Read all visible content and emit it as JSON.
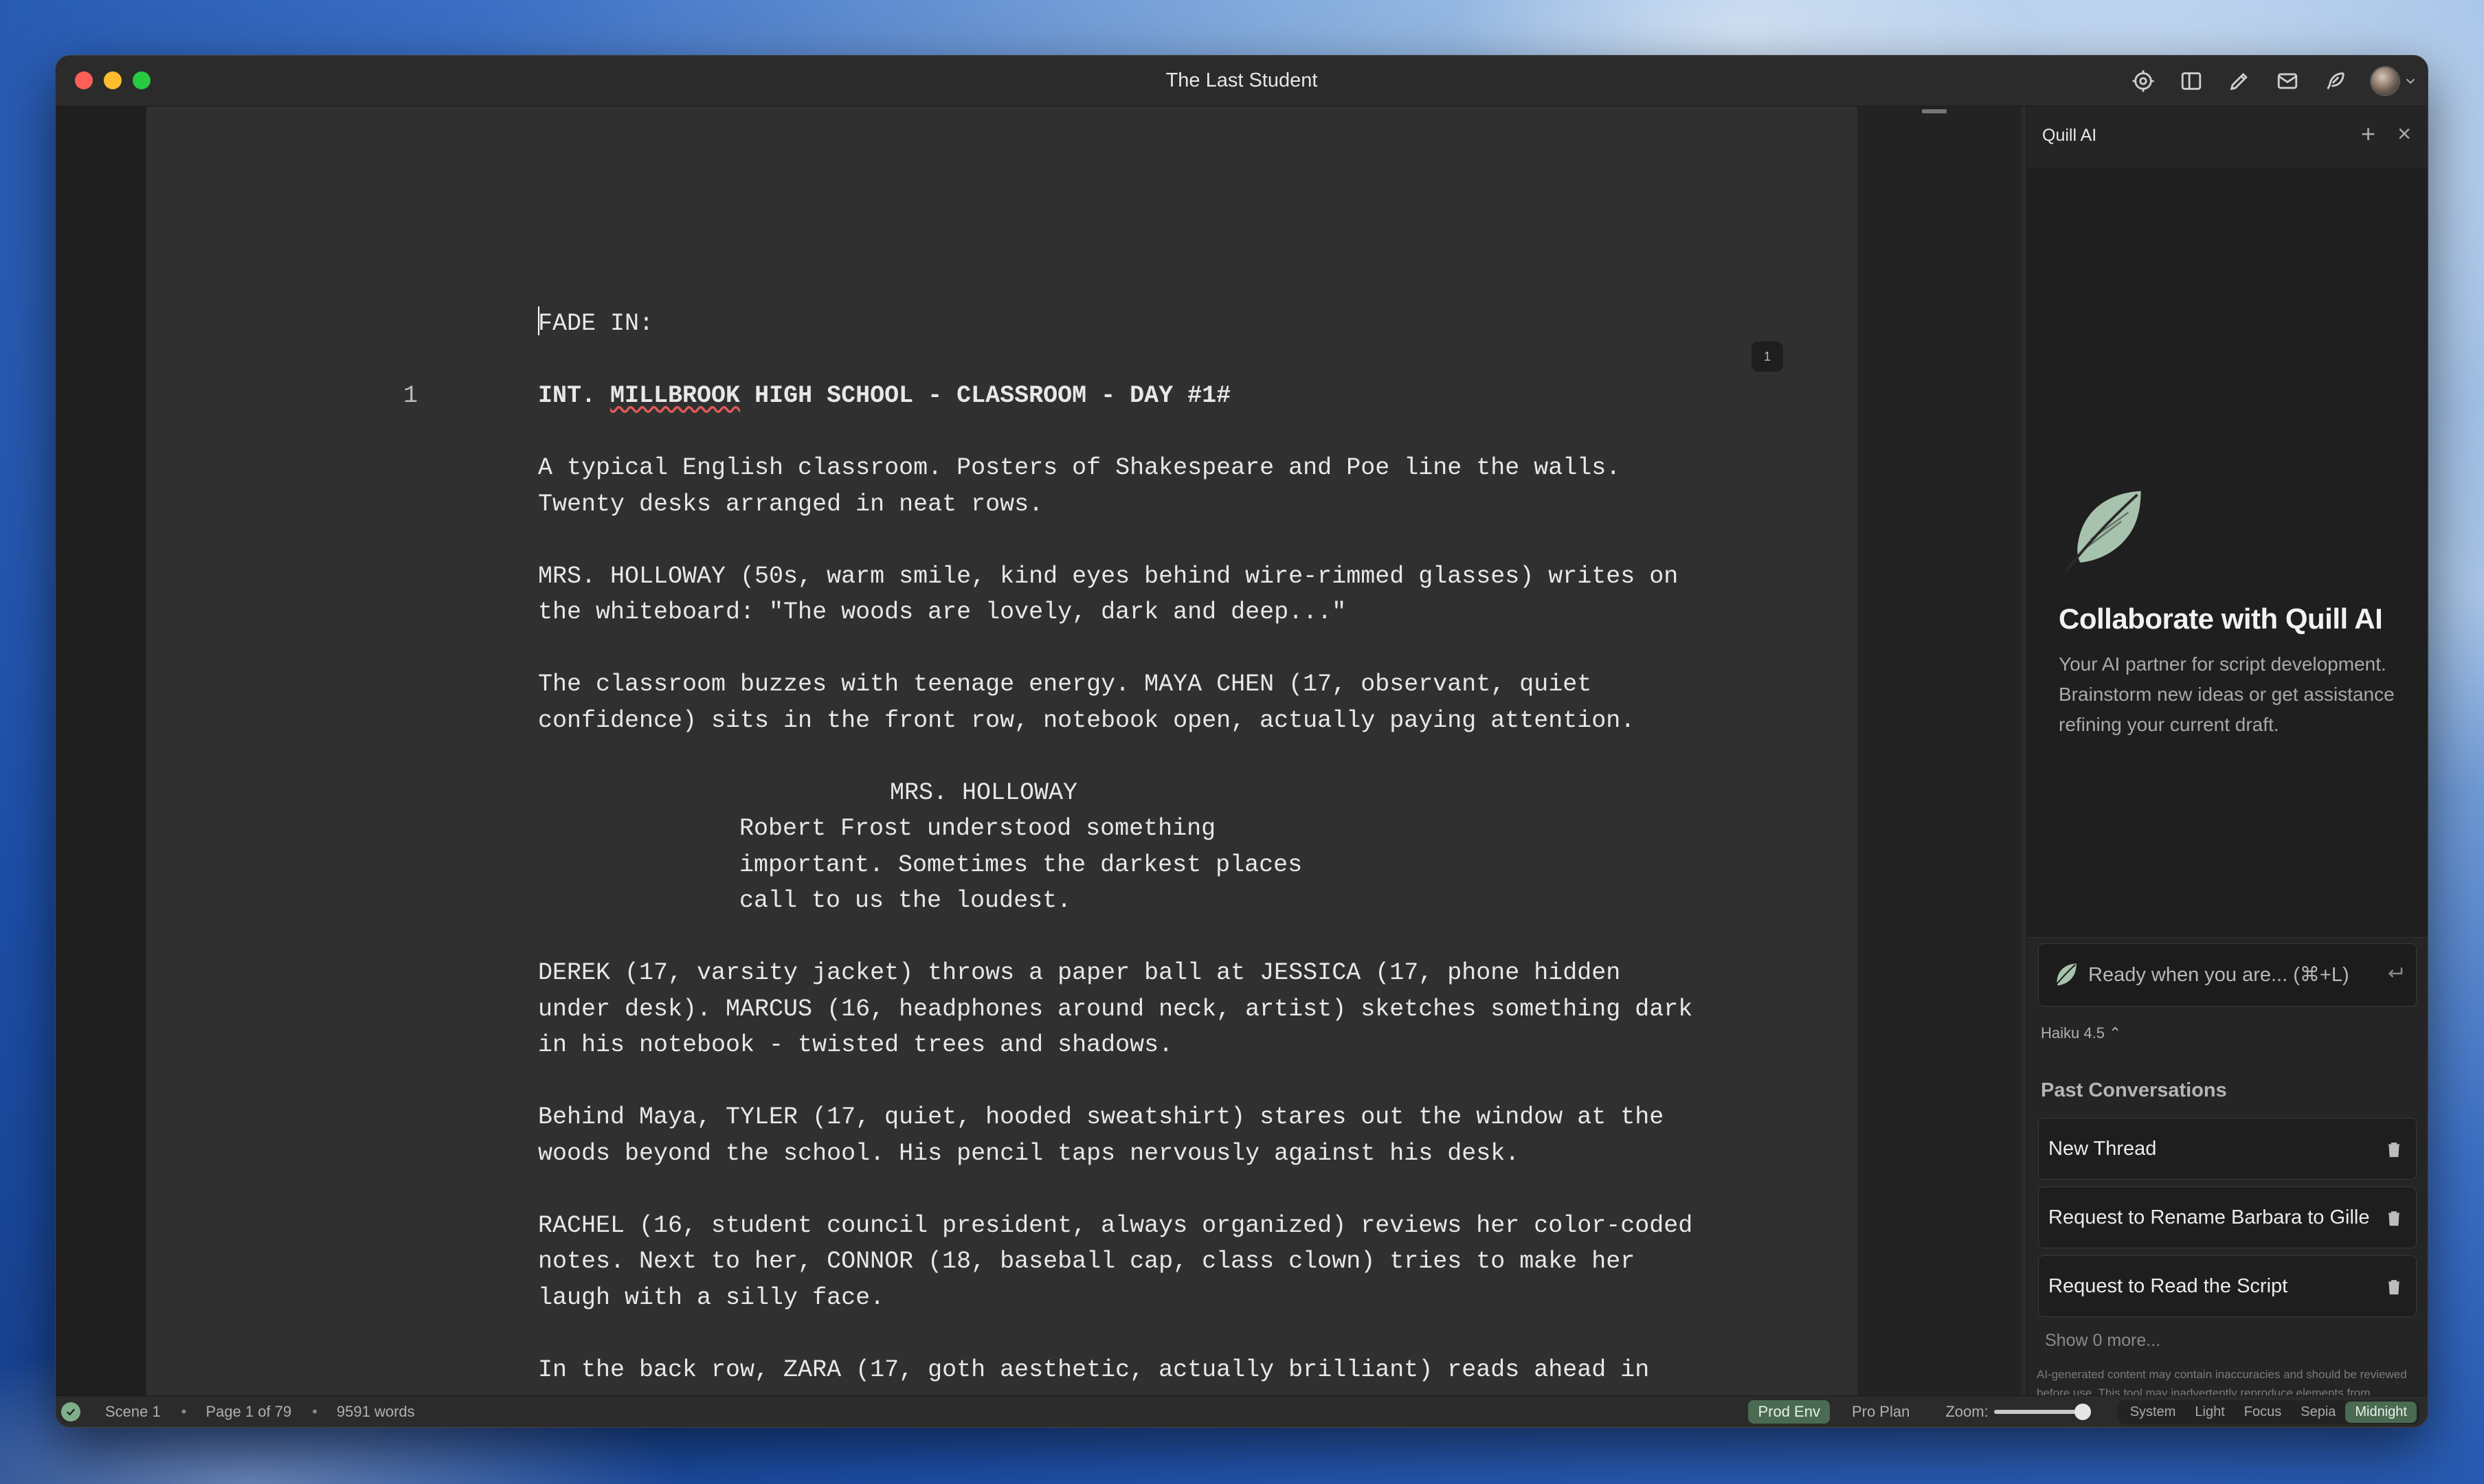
{
  "window": {
    "title": "The Last Student"
  },
  "toolbar": {
    "icons": [
      "target-icon",
      "sidebar-icon",
      "pencil-icon",
      "mail-icon",
      "feather-icon",
      "avatar"
    ]
  },
  "editor": {
    "page_number": "1",
    "scene_number": "1",
    "lines": {
      "transition": "FADE IN:",
      "heading_pre": "INT. ",
      "heading_misspelled": "MILLBROOK",
      "heading_post": " HIGH SCHOOL - CLASSROOM - DAY #1#",
      "action1": "A typical English classroom. Posters of Shakespeare and Poe line the walls.\nTwenty desks arranged in neat rows.",
      "action2": "MRS. HOLLOWAY (50s, warm smile, kind eyes behind wire-rimmed glasses) writes on\nthe whiteboard: \"The woods are lovely, dark and deep...\"",
      "action3": "The classroom buzzes with teenage energy. MAYA CHEN (17, observant, quiet\nconfidence) sits in the front row, notebook open, actually paying attention.",
      "character1": "MRS. HOLLOWAY",
      "dialogue1": "Robert Frost understood something\nimportant. Sometimes the darkest places\ncall to us the loudest.",
      "action4": "DEREK (17, varsity jacket) throws a paper ball at JESSICA (17, phone hidden\nunder desk). MARCUS (16, headphones around neck, artist) sketches something dark\nin his notebook - twisted trees and shadows.",
      "action5": "Behind Maya, TYLER (17, quiet, hooded sweatshirt) stares out the window at the\nwoods beyond the school. His pencil taps nervously against his desk.",
      "action6": "RACHEL (16, student council president, always organized) reviews her color-coded\nnotes. Next to her, CONNOR (18, baseball cap, class clown) tries to make her\nlaugh with a silly face.",
      "action7": "In the back row, ZARA (17, goth aesthetic, actually brilliant) reads ahead in"
    }
  },
  "sidebar": {
    "title": "Quill AI",
    "hero_title": "Collaborate with Quill AI",
    "hero_desc": "Your AI partner for script development. Brainstorm new ideas or get assistance refining your current draft.",
    "prompt_placeholder": "Ready when you are... (⌘+L)",
    "model": "Haiku 4.5 ⌃",
    "past_title": "Past Conversations",
    "conversations": [
      {
        "label": "New Thread"
      },
      {
        "label": "Request to Rename Barbara to Gille"
      },
      {
        "label": "Request to Read the Script"
      }
    ],
    "show_more": "Show 0 more...",
    "disclaimer": "AI-generated content may contain inaccuracies and should be reviewed before use. This tool may inadvertently reproduce elements from existing copyrighted works. Always verify originality and accuracy of generated content."
  },
  "statusbar": {
    "scene": "Scene 1",
    "page": "Page 1 of 79",
    "words": "9591 words",
    "env": "Prod Env",
    "plan": "Pro Plan",
    "zoom_label": "Zoom:",
    "zoom_value": 0.92,
    "themes": [
      "System",
      "Light",
      "Focus",
      "Sepia",
      "Midnight"
    ],
    "active_theme": "Midnight"
  },
  "colors": {
    "accent_green": "#4a6b52",
    "status_ok": "#7fae8a"
  }
}
